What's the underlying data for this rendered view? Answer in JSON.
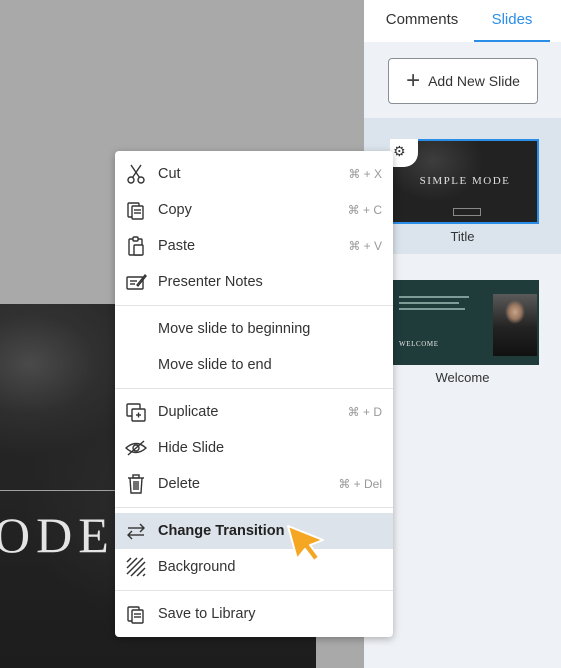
{
  "panel": {
    "tabs": [
      {
        "label": "Comments"
      },
      {
        "label": "Slides"
      }
    ],
    "add_slide_label": "Add New Slide",
    "slides": [
      {
        "caption": "Title",
        "thumb_title": "SIMPLE MODE"
      },
      {
        "caption": "Welcome",
        "thumb_title": "WELCOME"
      }
    ]
  },
  "canvas": {
    "slide_text": "ODE"
  },
  "context_menu": {
    "items": [
      {
        "label": "Cut",
        "shortcut": "⌘ + X",
        "icon": "scissors-icon"
      },
      {
        "label": "Copy",
        "shortcut": "⌘ + C",
        "icon": "copy-icon"
      },
      {
        "label": "Paste",
        "shortcut": "⌘ + V",
        "icon": "paste-icon"
      },
      {
        "label": "Presenter Notes",
        "shortcut": "",
        "icon": "presenter-notes-icon"
      },
      {
        "label": "Move slide to beginning",
        "shortcut": ""
      },
      {
        "label": "Move slide to end",
        "shortcut": ""
      },
      {
        "label": "Duplicate",
        "shortcut": "⌘ + D",
        "icon": "duplicate-icon"
      },
      {
        "label": "Hide Slide",
        "shortcut": "",
        "icon": "hide-eye-icon"
      },
      {
        "label": "Delete",
        "shortcut": "⌘ + Del",
        "icon": "trash-icon"
      },
      {
        "label": "Change Transition",
        "shortcut": "",
        "icon": "transition-arrows-icon"
      },
      {
        "label": "Background",
        "shortcut": "",
        "icon": "background-hatch-icon"
      },
      {
        "label": "Save to Library",
        "shortcut": "",
        "icon": "save-library-icon"
      }
    ]
  },
  "colors": {
    "accent": "#2a8ee8",
    "highlight": "#dde3ea",
    "cursor": "#f5a623"
  }
}
